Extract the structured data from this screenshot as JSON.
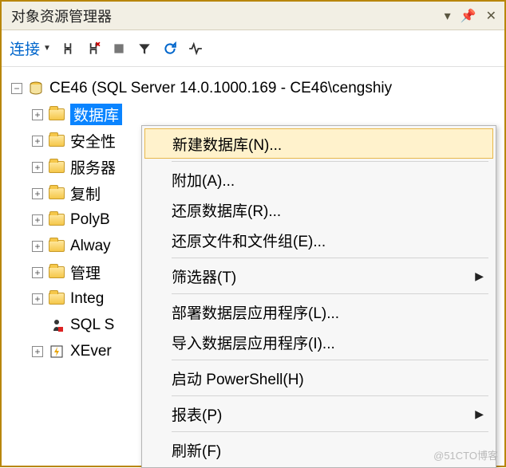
{
  "panel": {
    "title": "对象资源管理器"
  },
  "toolbar": {
    "connect_label": "连接"
  },
  "tree": {
    "root_label": "CE46 (SQL Server 14.0.1000.169 - CE46\\cengshiy",
    "items": [
      {
        "label": "数据库",
        "icon": "folder",
        "selected": true
      },
      {
        "label": "安全性",
        "icon": "folder"
      },
      {
        "label": "服务器",
        "icon": "folder"
      },
      {
        "label": "复制",
        "icon": "folder"
      },
      {
        "label": "PolyB",
        "icon": "folder"
      },
      {
        "label": "Alway",
        "icon": "folder"
      },
      {
        "label": "管理",
        "icon": "folder"
      },
      {
        "label": "Integ",
        "icon": "folder"
      },
      {
        "label": "SQL S",
        "icon": "agent",
        "no_expand": true
      },
      {
        "label": "XEver",
        "icon": "xevent"
      }
    ]
  },
  "context_menu": {
    "items": [
      {
        "label": "新建数据库(N)...",
        "highlight": true
      },
      {
        "sep": true
      },
      {
        "label": "附加(A)..."
      },
      {
        "label": "还原数据库(R)..."
      },
      {
        "label": "还原文件和文件组(E)..."
      },
      {
        "sep": true
      },
      {
        "label": "筛选器(T)",
        "submenu": true
      },
      {
        "sep": true
      },
      {
        "label": "部署数据层应用程序(L)..."
      },
      {
        "label": "导入数据层应用程序(I)..."
      },
      {
        "sep": true
      },
      {
        "label": "启动 PowerShell(H)"
      },
      {
        "sep": true
      },
      {
        "label": "报表(P)",
        "submenu": true
      },
      {
        "sep": true
      },
      {
        "label": "刷新(F)"
      }
    ]
  },
  "watermark": "@51CTO博客"
}
